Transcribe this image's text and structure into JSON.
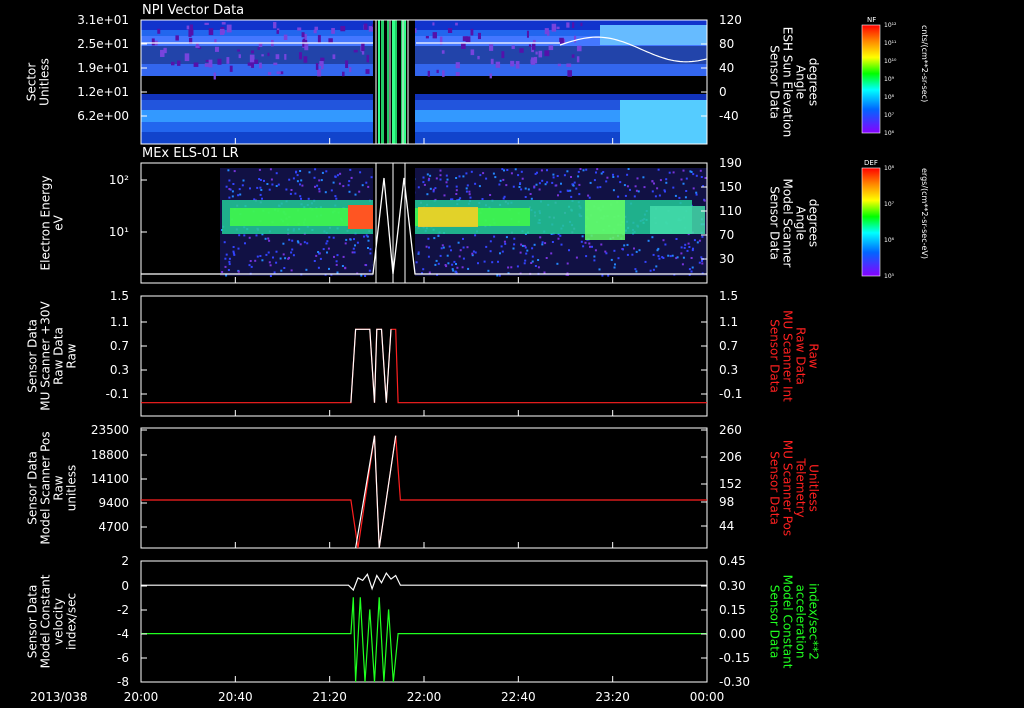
{
  "figure": {
    "date_label": "2013/038",
    "time_ticks": [
      "20:00",
      "20:40",
      "21:20",
      "22:00",
      "22:40",
      "23:20",
      "00:00"
    ]
  },
  "colors": {
    "background": "#000000",
    "axis": "#ffffff",
    "red_label": "#ff2020",
    "green_label": "#20ff20"
  },
  "chart_data": [
    {
      "type": "heatmap",
      "title": "NPI Vector Data",
      "ylabel_lines": [
        "Sector",
        "Unitless"
      ],
      "yticks": [
        "3.1e+01",
        "2.5e+01",
        "1.9e+01",
        "1.2e+01",
        "6.2e+00"
      ],
      "ylabel_right_lines": [
        "Sensor Data",
        "ESH Sun Elevation",
        "Angle",
        "degrees"
      ],
      "yticks_right": [
        "120",
        "80",
        "40",
        "0",
        "-40"
      ],
      "colorbar": {
        "label": "NF",
        "unit": "cnts/(cm**2-sr-sec)",
        "ticks": [
          "10¹²",
          "10¹¹",
          "10¹⁰",
          "10⁹",
          "10⁸",
          "10⁷",
          "10⁶"
        ]
      }
    },
    {
      "type": "heatmap",
      "title": "MEx ELS-01 LR",
      "ylabel_lines": [
        "Electron Energy",
        "eV"
      ],
      "yticks": [
        "10²",
        "10¹"
      ],
      "ylabel_right_lines": [
        "Sensor Data",
        "Model Scanner",
        "Angle",
        "degrees"
      ],
      "yticks_right": [
        "190",
        "150",
        "110",
        "70",
        "30"
      ],
      "colorbar": {
        "label": "DEF",
        "unit": "ergs/(cm**2-sr-sec-eV)",
        "ticks": [
          "10⁸",
          "10⁷",
          "10⁶",
          "10⁵"
        ]
      }
    },
    {
      "type": "line",
      "ylabel_lines": [
        "Sensor Data",
        "MU Scanner +30V",
        "Raw Data",
        "Raw"
      ],
      "yticks": [
        "1.5",
        "1.1",
        "0.7",
        "0.3",
        "-0.1"
      ],
      "ylabel_right_lines": [
        "Sensor Data",
        "MU Scanner Int",
        "Raw Data",
        "Raw"
      ],
      "yticks_right": [
        "1.5",
        "1.1",
        "0.7",
        "0.3",
        "-0.1"
      ],
      "ylim": [
        -0.3,
        1.5
      ],
      "series": [
        {
          "color": "#ff2020",
          "x": [
            "20:00",
            "21:29",
            "21:31",
            "21:37",
            "21:39",
            "21:40",
            "21:42",
            "21:44",
            "21:46",
            "21:48",
            "21:49",
            "00:00"
          ],
          "y": [
            -0.1,
            -0.1,
            1.0,
            1.0,
            -0.1,
            1.0,
            1.0,
            -0.1,
            1.0,
            1.0,
            -0.1,
            -0.1
          ]
        },
        {
          "color": "#ffffff",
          "x": [
            "21:29",
            "21:31",
            "21:37",
            "21:39",
            "21:40",
            "21:42",
            "21:44",
            "21:46"
          ],
          "y": [
            -0.1,
            1.0,
            1.0,
            -0.1,
            1.0,
            1.0,
            -0.1,
            1.0
          ]
        }
      ]
    },
    {
      "type": "line",
      "ylabel_lines": [
        "Sensor Data",
        "Model Scanner Pos",
        "Raw",
        "unitless"
      ],
      "yticks": [
        "23500",
        "18800",
        "14100",
        "9400",
        "4700"
      ],
      "ylabel_right_lines": [
        "Sensor Data",
        "MU Scanner Pos",
        "Telemetry",
        "Unitless"
      ],
      "yticks_right": [
        "260",
        "206",
        "152",
        "98",
        "44"
      ],
      "ylim": [
        0,
        23500
      ],
      "series": [
        {
          "color": "#ff2020",
          "x": [
            "20:00",
            "21:29",
            "21:32",
            "21:39",
            "21:41",
            "21:48",
            "21:50",
            "00:00"
          ],
          "y": [
            9400,
            9400,
            0,
            22000,
            0,
            22000,
            9400,
            9400
          ]
        },
        {
          "color": "#ffffff",
          "x": [
            "21:31",
            "21:39",
            "21:41",
            "21:48"
          ],
          "y": [
            0,
            22000,
            0,
            22000
          ]
        }
      ]
    },
    {
      "type": "line",
      "ylabel_lines": [
        "Sensor Data",
        "Model Constant",
        "velocity",
        "index/sec"
      ],
      "yticks": [
        "2",
        "0",
        "-2",
        "-4",
        "-6",
        "-8"
      ],
      "ylabel_right_lines": [
        "Sensor Data",
        "Model Constant",
        "acceleration",
        "index/sec**2"
      ],
      "yticks_right": [
        "0.45",
        "0.30",
        "0.15",
        "0.00",
        "-0.15",
        "-0.30"
      ],
      "ylim": [
        -8,
        2
      ],
      "series": [
        {
          "color": "#ffffff",
          "x": [
            "20:00",
            "21:28",
            "21:30",
            "21:32",
            "21:34",
            "21:36",
            "21:38",
            "21:40",
            "21:42",
            "21:44",
            "21:46",
            "21:48",
            "21:50",
            "00:00"
          ],
          "y": [
            0,
            0,
            -0.4,
            0.6,
            0.4,
            0.9,
            -0.3,
            0.8,
            0.2,
            1.0,
            0.5,
            0.8,
            0,
            0
          ]
        },
        {
          "color": "#20ff20",
          "x": [
            "20:00",
            "21:29",
            "21:30",
            "21:31",
            "21:33",
            "21:35",
            "21:37",
            "21:39",
            "21:41",
            "21:43",
            "21:45",
            "21:47",
            "21:49",
            "00:00"
          ],
          "y": [
            -4,
            -4,
            -1,
            -8,
            -1,
            -8,
            -2,
            -8,
            -1,
            -8,
            -2,
            -8,
            -4,
            -4
          ]
        }
      ]
    }
  ]
}
